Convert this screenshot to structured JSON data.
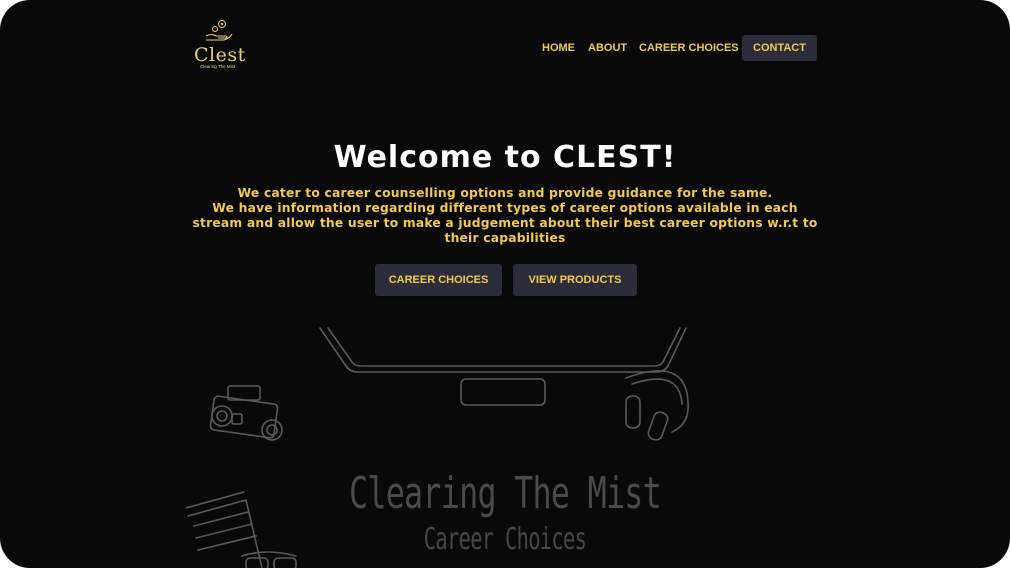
{
  "brand": {
    "name": "Clest",
    "tagline": "Clearing The Mist",
    "accent": "#f2c94c",
    "background": "#090909"
  },
  "nav": {
    "items": [
      "HOME",
      "ABOUT",
      "CAREER CHOICES"
    ],
    "contact_label": "CONTACT"
  },
  "hero": {
    "title": "Welcome to CLEST!",
    "line1": "We cater to career counselling options and provide guidance for the same.",
    "line2": "We have information regarding different types of career options available in each stream and allow the user to make a judgement about their best career options w.r.t to their capabilities",
    "primary_button": "CAREER CHOICES",
    "secondary_button": "VIEW PRODUCTS"
  },
  "illustration": {
    "heading": "Clearing The Mist",
    "subheading": "Career Choices",
    "icons": [
      "laptop-icon",
      "camera-icon",
      "headphones-icon",
      "phone-icon",
      "notebook-icon",
      "glasses-icon"
    ]
  }
}
